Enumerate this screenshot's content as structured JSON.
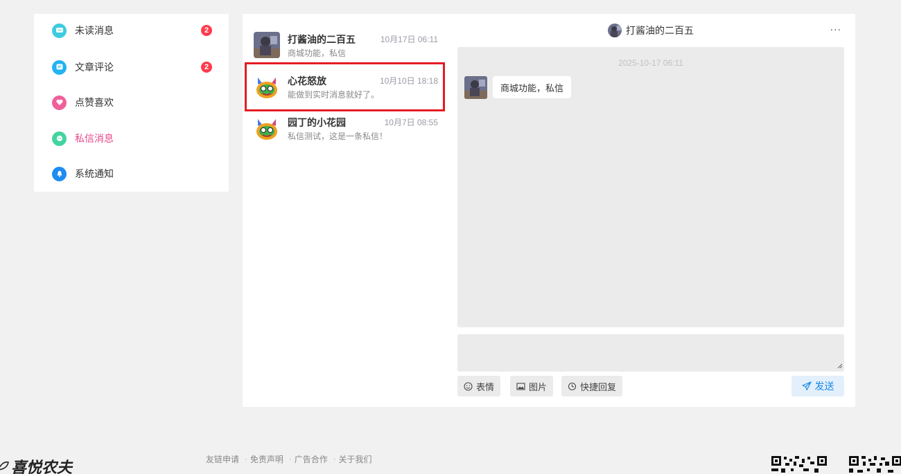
{
  "sidebar": {
    "items": [
      {
        "label": "未读消息",
        "badge": "2",
        "icon": "chat-bubble-icon",
        "color": "#3ecbe0"
      },
      {
        "label": "文章评论",
        "badge": "2",
        "icon": "comment-icon",
        "color": "#23b3f2"
      },
      {
        "label": "点赞喜欢",
        "badge": "",
        "icon": "heart-icon",
        "color": "#f0609a"
      },
      {
        "label": "私信消息",
        "badge": "",
        "icon": "message-icon",
        "color": "#44d4a0",
        "active": true
      },
      {
        "label": "系统通知",
        "badge": "",
        "icon": "bell-icon",
        "color": "#1e8cf0"
      }
    ]
  },
  "conversations": [
    {
      "name": "打酱油的二百五",
      "time": "10月17日 06:11",
      "snippet": "商城功能，私信"
    },
    {
      "name": "心花怒放",
      "time": "10月10日 18:18",
      "snippet": "能做到实时消息就好了。"
    },
    {
      "name": "园丁的小花园",
      "time": "10月7日 08:55",
      "snippet": "私信测试，这是一条私信！"
    }
  ],
  "chat": {
    "title": "打酱油的二百五",
    "more": "···",
    "date": "2025-10-17 06:11",
    "messages": [
      {
        "text": "商城功能，私信"
      }
    ]
  },
  "toolbar": {
    "emoji_label": "表情",
    "image_label": "图片",
    "quick_reply_label": "快捷回复",
    "send_label": "发送"
  },
  "footer": {
    "logo_text": "喜悦农夫",
    "links": [
      "友链申请",
      "免责声明",
      "广告合作",
      "关于我们"
    ]
  },
  "colors": {
    "accent_pink": "#e8488c",
    "badge_red": "#ff3b4d",
    "send_blue": "#1a8ae8",
    "highlight_red": "#e41c23"
  }
}
